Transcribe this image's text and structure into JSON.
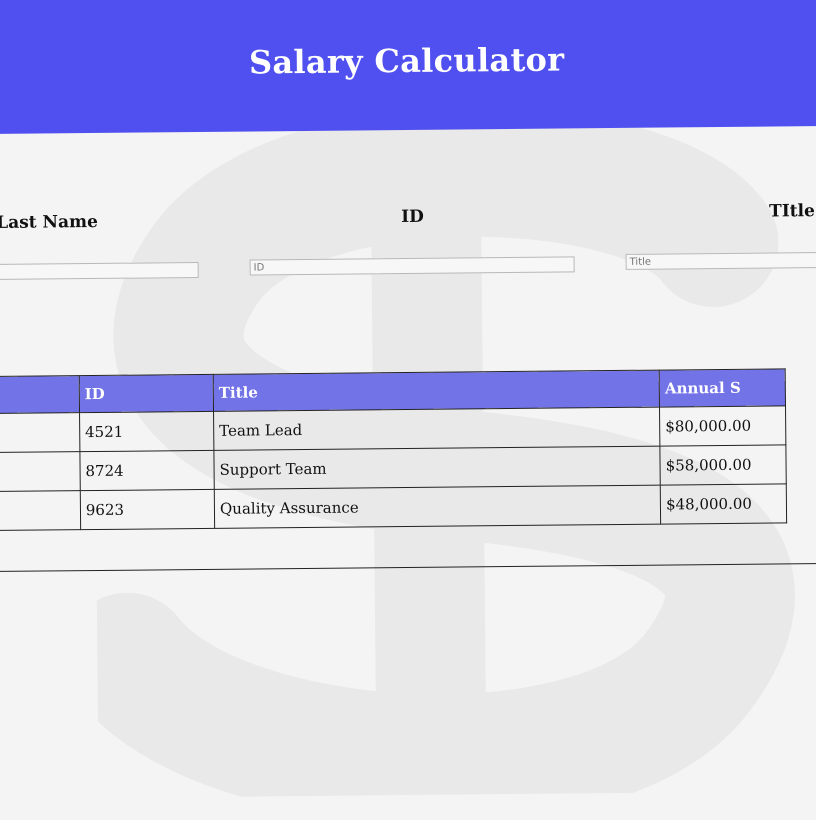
{
  "header": {
    "title": "Salary Calculator"
  },
  "form": {
    "last_name": {
      "label": "Last Name",
      "placeholder": ""
    },
    "id": {
      "label": "ID",
      "placeholder": "ID"
    },
    "title": {
      "label": "TItle",
      "placeholder": "Title"
    }
  },
  "table": {
    "columns": [
      "",
      "ID",
      "Title",
      "Annual S"
    ],
    "rows": [
      {
        "id": "4521",
        "title": "Team Lead",
        "salary": "$80,000.00"
      },
      {
        "id": "8724",
        "title": "Support Team",
        "salary": "$58,000.00"
      },
      {
        "id": "9623",
        "title": "Quality Assurance",
        "salary": "$48,000.00"
      }
    ]
  },
  "watermark": {
    "icon": "dollar-sign-icon",
    "color": "#e6e6e6"
  },
  "colors": {
    "header": "#5050f0",
    "table_header": "#7373e8",
    "background": "#f4f4f4"
  }
}
